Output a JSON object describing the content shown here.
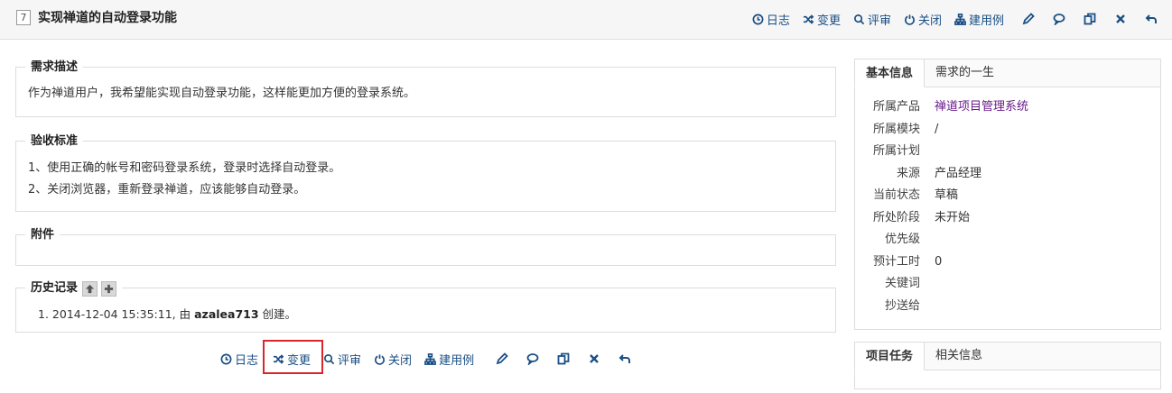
{
  "story": {
    "id": "7",
    "title": "实现禅道的自动登录功能"
  },
  "toolbar": {
    "log": "日志",
    "change": "变更",
    "review": "评审",
    "close": "关闭",
    "create_case": "建用例"
  },
  "sections": {
    "description": {
      "legend": "需求描述",
      "text": "作为禅道用户，我希望能实现自动登录功能，这样能更加方便的登录系统。"
    },
    "acceptance": {
      "legend": "验收标准",
      "lines": [
        "1、使用正确的帐号和密码登录系统，登录时选择自动登录。",
        "2、关闭浏览器，重新登录禅道，应该能够自动登录。"
      ]
    },
    "attachments": {
      "legend": "附件"
    },
    "history": {
      "legend": "历史记录",
      "entries": [
        {
          "num": "1.",
          "time": "2014-12-04 15:35:11, 由 ",
          "user": "azalea713",
          "action": " 创建。"
        }
      ]
    }
  },
  "side": {
    "tabs": [
      "基本信息",
      "需求的一生"
    ],
    "rows": [
      {
        "label": "所属产品",
        "value": "禅道项目管理系统"
      },
      {
        "label": "所属模块",
        "value": "/"
      },
      {
        "label": "所属计划",
        "value": ""
      },
      {
        "label": "来源",
        "value": "产品经理"
      },
      {
        "label": "当前状态",
        "value": "草稿"
      },
      {
        "label": "所处阶段",
        "value": "未开始"
      },
      {
        "label": "优先级",
        "value": ""
      },
      {
        "label": "预计工时",
        "value": "0"
      },
      {
        "label": "关键词",
        "value": ""
      },
      {
        "label": "抄送给",
        "value": ""
      }
    ],
    "bottom_tabs": [
      "项目任务",
      "相关信息"
    ]
  },
  "colors": {
    "link": "#1a4f85",
    "product_link": "#6a1b8a",
    "highlight": "#d9262c"
  },
  "icons": [
    "clock-icon",
    "shuffle-icon",
    "search-icon",
    "power-icon",
    "sitemap-icon",
    "pencil-icon",
    "comment-icon",
    "copy-icon",
    "delete-icon",
    "back-icon",
    "arrow-up-icon",
    "plus-icon"
  ]
}
